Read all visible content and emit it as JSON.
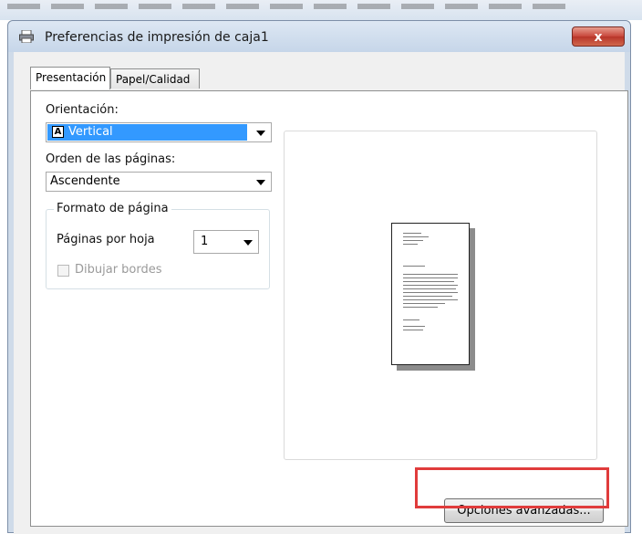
{
  "window": {
    "title": "Preferencias de impresión de caja1",
    "close_glyph": "x"
  },
  "tabs": [
    {
      "label": "Presentación",
      "active": true
    },
    {
      "label": "Papel/Calidad",
      "active": false
    }
  ],
  "orientation": {
    "label": "Orientación:",
    "value": "Vertical",
    "icon_glyph": "A"
  },
  "page_order": {
    "label": "Orden de las páginas:",
    "value": "Ascendente"
  },
  "page_format": {
    "title": "Formato de página",
    "pages_per_sheet_label": "Páginas por hoja",
    "pages_per_sheet_value": "1",
    "draw_borders_label": "Dibujar bordes",
    "draw_borders_checked": false
  },
  "advanced_button": {
    "label": "Opciones avanzadas..."
  },
  "colors": {
    "highlight": "#e03c3c",
    "selection": "#3399ff"
  },
  "icons": {
    "title": "printer-icon",
    "close": "close-icon"
  }
}
